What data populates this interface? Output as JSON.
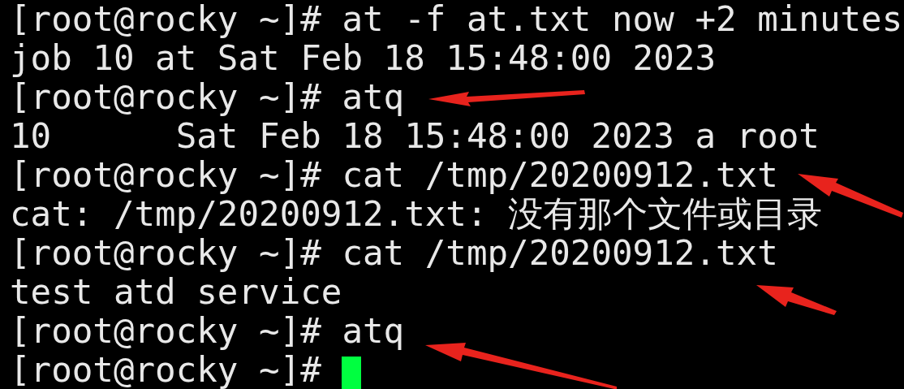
{
  "terminal": {
    "lines": [
      {
        "text": "[root@rocky ~]# at -f at.txt now +2 minutes"
      },
      {
        "text": "job 10 at Sat Feb 18 15:48:00 2023"
      },
      {
        "text": "[root@rocky ~]# atq"
      },
      {
        "text": "10      Sat Feb 18 15:48:00 2023 a root"
      },
      {
        "text": "[root@rocky ~]# cat /tmp/20200912.txt"
      },
      {
        "text": "cat: /tmp/20200912.txt: 没有那个文件或目录"
      },
      {
        "text": "[root@rocky ~]# cat /tmp/20200912.txt"
      },
      {
        "text": "test atd service"
      },
      {
        "text": "[root@rocky ~]# atq"
      },
      {
        "text": "[root@rocky ~]# "
      }
    ],
    "cursor_visible": true
  }
}
